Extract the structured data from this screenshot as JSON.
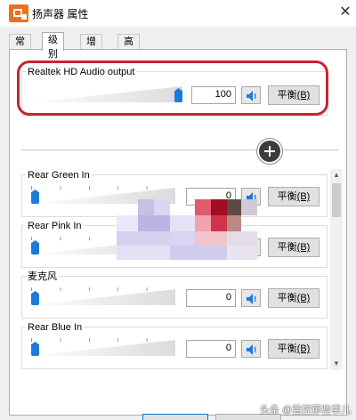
{
  "window": {
    "title": "扬声器 属性",
    "close_symbol": "✕"
  },
  "tabs": [
    {
      "label": "常规"
    },
    {
      "label": "级别"
    },
    {
      "label": "增强"
    },
    {
      "label": "高级"
    }
  ],
  "balance_label": "平衡",
  "balance_accel": "(B)",
  "channels": [
    {
      "name": "Realtek HD Audio output",
      "value": "100",
      "level": 1.0
    },
    {
      "name": "Rear Green In",
      "value": "0",
      "level": 0.0
    },
    {
      "name": "Rear Pink In",
      "value": "",
      "level": 0.0
    },
    {
      "name": "麦克风",
      "value": "0",
      "level": 0.0
    },
    {
      "name": "Rear Blue In",
      "value": "0",
      "level": 0.0
    }
  ],
  "icons": {
    "app": "speaker-properties-icon",
    "mute": "speaker-icon",
    "add": "plus-icon"
  },
  "colors": {
    "accent": "#1e7ad8",
    "highlight": "#c4262e"
  },
  "watermark": "头条 @监控那些事儿"
}
